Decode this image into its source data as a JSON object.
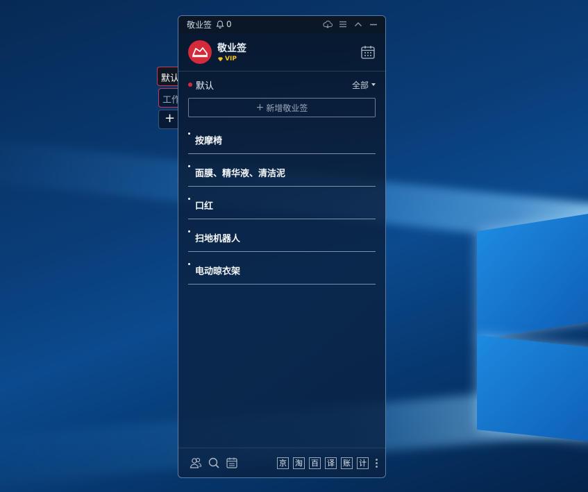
{
  "side_tabs": [
    {
      "label": "默认"
    },
    {
      "label": "工作"
    },
    {
      "label": "+"
    }
  ],
  "titlebar": {
    "app_name": "敬业签",
    "notification_count": "0",
    "icons": [
      "bell-icon",
      "cloud-sync-icon",
      "menu-icon",
      "collapse-icon",
      "minimize-icon"
    ]
  },
  "header": {
    "title": "敬业签",
    "vip_label": "VIP",
    "logo_color": "#d42a3a",
    "vip_color": "#f0c020",
    "calendar_icon": "calendar-icon"
  },
  "section": {
    "name": "默认",
    "filter": "全部",
    "accent": "#d42a3a"
  },
  "add_button": {
    "label": "新增敬业签"
  },
  "notes": [
    {
      "text": "按摩椅"
    },
    {
      "text": "面膜、精华液、清洁泥"
    },
    {
      "text": "口红"
    },
    {
      "text": "扫地机器人"
    },
    {
      "text": "电动晾衣架"
    }
  ],
  "footer": {
    "left_icons": [
      "contacts-icon",
      "search-icon",
      "calendar-list-icon"
    ],
    "buttons": [
      "京",
      "淘",
      "百",
      "译",
      "账",
      "计"
    ]
  }
}
